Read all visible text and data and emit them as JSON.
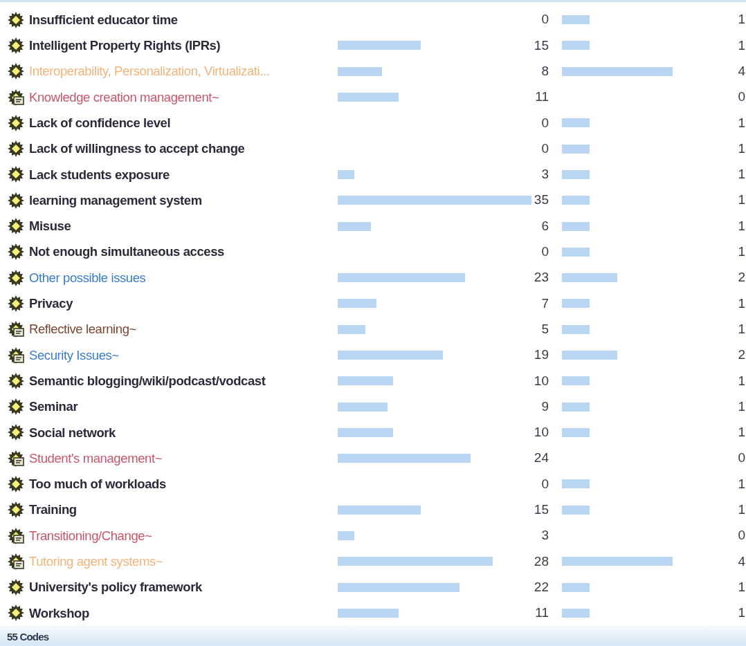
{
  "codes": [
    {
      "kind": "code",
      "name": "Insufficient educator time",
      "grounded": "0",
      "density": "1"
    },
    {
      "kind": "code",
      "name": "Intelligent Property Rights (IPRs)",
      "grounded": "15",
      "density": "1"
    },
    {
      "kind": "code",
      "name": "Interoperability, Personalization, Virtualizati...",
      "color": "#f2b47a",
      "grounded": "8",
      "density": "4"
    },
    {
      "kind": "memo-code",
      "name": "Knowledge creation management~",
      "color": "#c8566a",
      "grounded": "11",
      "density": "0"
    },
    {
      "kind": "code",
      "name": "Lack of confidence level",
      "grounded": "0",
      "density": "1"
    },
    {
      "kind": "code",
      "name": "Lack of willingness to accept change",
      "grounded": "0",
      "density": "1"
    },
    {
      "kind": "code",
      "name": "Lack students exposure",
      "grounded": "3",
      "density": "1"
    },
    {
      "kind": "code",
      "name": "learning management system",
      "grounded": "35",
      "density": "1"
    },
    {
      "kind": "code",
      "name": "Misuse",
      "grounded": "6",
      "density": "1"
    },
    {
      "kind": "code",
      "name": "Not enough simultaneous access",
      "grounded": "0",
      "density": "1"
    },
    {
      "kind": "code",
      "name": "Other possible issues",
      "color": "#3a7cc8",
      "grounded": "23",
      "density": "2"
    },
    {
      "kind": "code",
      "name": "Privacy",
      "grounded": "7",
      "density": "1"
    },
    {
      "kind": "memo-code",
      "name": "Reflective learning~",
      "color": "#7a4632",
      "grounded": "5",
      "density": "1"
    },
    {
      "kind": "memo-code",
      "name": "Security Issues~",
      "color": "#3a7cc8",
      "grounded": "19",
      "density": "2"
    },
    {
      "kind": "code",
      "name": "Semantic blogging/wiki/podcast/vodcast",
      "grounded": "10",
      "density": "1"
    },
    {
      "kind": "code",
      "name": "Seminar",
      "grounded": "9",
      "density": "1"
    },
    {
      "kind": "code",
      "name": "Social network",
      "grounded": "10",
      "density": "1"
    },
    {
      "kind": "memo-code",
      "name": "Student's management~",
      "color": "#c8566a",
      "grounded": "24",
      "density": "0"
    },
    {
      "kind": "code",
      "name": "Too much of workloads",
      "grounded": "0",
      "density": "1"
    },
    {
      "kind": "code",
      "name": "Training",
      "grounded": "15",
      "density": "1"
    },
    {
      "kind": "memo-code",
      "name": "Transitioning/Change~",
      "color": "#c8566a",
      "grounded": "3",
      "density": "0"
    },
    {
      "kind": "memo-code",
      "name": "Tutoring agent systems~",
      "color": "#f2b47a",
      "grounded": "28",
      "density": "4"
    },
    {
      "kind": "code",
      "name": "University's policy framework",
      "grounded": "22",
      "density": "1"
    },
    {
      "kind": "code",
      "name": "Workshop",
      "grounded": "11",
      "density": "1"
    }
  ],
  "status_bar": {
    "text": "55 Codes"
  }
}
